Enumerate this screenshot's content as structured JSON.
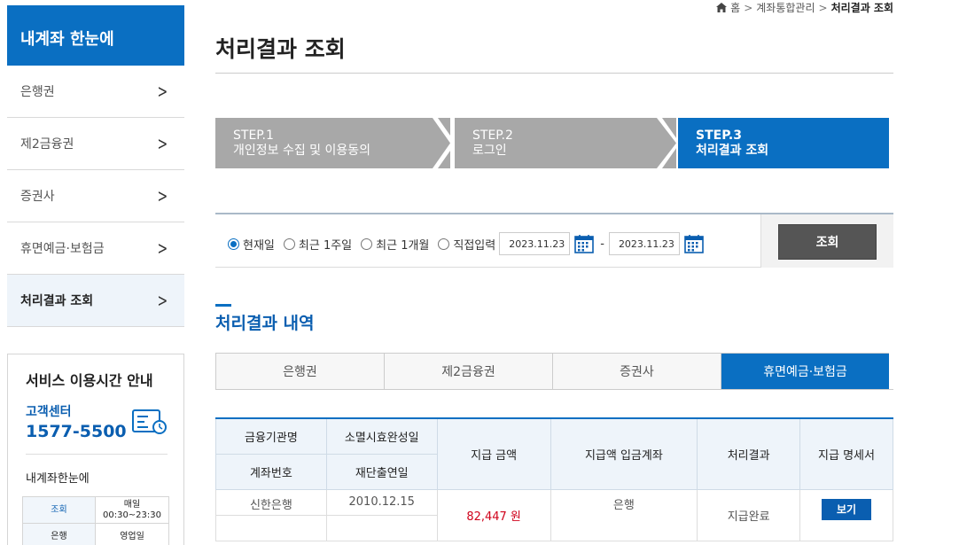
{
  "sidebar": {
    "title": "내계좌 한눈에",
    "items": [
      {
        "label": "은행권"
      },
      {
        "label": "제2금융권"
      },
      {
        "label": "증권사"
      },
      {
        "label": "휴면예금·보험금"
      },
      {
        "label": "처리결과 조회",
        "active": true
      }
    ]
  },
  "service": {
    "title": "서비스 이용시간 안내",
    "cc_label": "고객센터",
    "cc_phone": "1577-5500",
    "sub_title": "내계좌한눈에",
    "row1_label": "조회",
    "row1_value1": "매일",
    "row1_value2": "00:30~23:30",
    "row2_label": "은행",
    "row2_value": "영업일"
  },
  "breadcrumb": {
    "home": "홈",
    "level1": "계좌통합관리",
    "current": "처리결과 조회"
  },
  "page_title": "처리결과 조회",
  "steps": [
    {
      "num": "STEP.1",
      "label": "개인정보 수집 및 이용동의"
    },
    {
      "num": "STEP.2",
      "label": "로그인"
    },
    {
      "num": "STEP.3",
      "label": "처리결과 조회"
    }
  ],
  "search": {
    "options": [
      "현재일",
      "최근 1주일",
      "최근 1개월",
      "직접입력"
    ],
    "selected": "현재일",
    "date_from": "2023.11.23",
    "date_to": "2023.11.23",
    "dash": "-",
    "button": "조회"
  },
  "section_title": "처리결과 내역",
  "tabs": [
    "은행권",
    "제2금융권",
    "증권사",
    "휴면예금·보험금"
  ],
  "active_tab": "휴면예금·보험금",
  "table": {
    "headers": {
      "institution": "금융기관명",
      "extinct_date": "소멸시효완성일",
      "account_no": "계좌번호",
      "refund_date": "재단출연일",
      "amount": "지급 금액",
      "deposit_account": "지급액 입금계좌",
      "result": "처리결과",
      "statement": "지급 명세서"
    },
    "rows": [
      {
        "institution": "신한은행",
        "extinct_date": "2010.12.15",
        "account_no": "",
        "refund_date": "",
        "amount": "82,447 원",
        "deposit_account": "은행",
        "result": "지급완료",
        "statement_button": "보기"
      }
    ]
  },
  "colors": {
    "primary": "#0a6fc2",
    "step_inactive": "#a8a8a8",
    "amount": "#d0021b",
    "search_button": "#555555"
  }
}
